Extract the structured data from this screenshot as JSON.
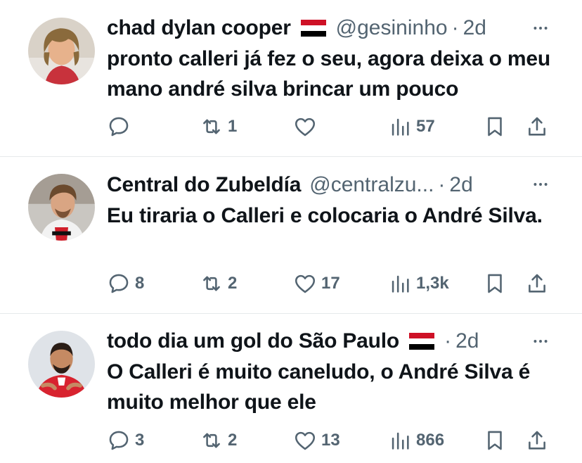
{
  "tweets": [
    {
      "name": "chad dylan cooper",
      "handle": "@gesininho",
      "separator": "·",
      "time": "2d",
      "text": "pronto calleri já fez o seu, agora deixa o meu mano andré silva brincar um pouco",
      "replies": "",
      "reposts": "1",
      "likes": "",
      "views": "57"
    },
    {
      "name": "Central do Zubeldía",
      "handle": "@centralzu...",
      "separator": "·",
      "time": "2d",
      "text": "Eu tiraria o Calleri e colocaria o André Silva.",
      "replies": "8",
      "reposts": "2",
      "likes": "17",
      "views": "1,3k"
    },
    {
      "name": "todo dia um gol do São Paulo",
      "handle": "",
      "separator": "·",
      "time": "2d",
      "text": "O Calleri é muito caneludo, o André Silva é muito melhor que ele",
      "replies": "3",
      "reposts": "2",
      "likes": "13",
      "views": "866"
    }
  ],
  "colors": {
    "text_primary": "#0f1419",
    "text_secondary": "#536471",
    "divider": "#e6e9eb",
    "flag_red": "#ce1126",
    "flag_white": "#ffffff",
    "flag_black": "#000000"
  },
  "icons": [
    "reply-icon",
    "repost-icon",
    "like-icon",
    "views-icon",
    "bookmark-icon",
    "share-icon",
    "more-icon",
    "flag-icon"
  ]
}
